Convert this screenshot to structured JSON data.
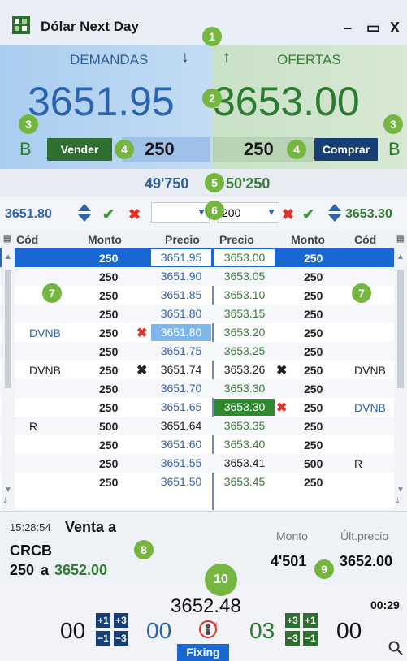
{
  "window": {
    "title": "Dólar Next Day",
    "controls": {
      "minimize": "–",
      "maximize": "▭",
      "close": "X"
    }
  },
  "header": {
    "demand_label": "DEMANDAS",
    "offer_label": "OFERTAS",
    "bid": "3651.95",
    "ask": "3653.00",
    "b_left": "B",
    "b_right": "B",
    "sell_button": "Vender",
    "buy_button": "Comprar",
    "sell_qty": "250",
    "buy_qty": "250",
    "vol_left": "49'750",
    "vol_right": "50'250"
  },
  "controls_row": {
    "left_price": "3651.80",
    "right_qty": "200",
    "right_price": "3653.30"
  },
  "table": {
    "headers": {
      "cod_l": "Cód",
      "mon_l": "Monto",
      "pre_l": "Precio",
      "pre_r": "Precio",
      "mon_r": "Monto",
      "cod_r": "Cód"
    },
    "rows": [
      {
        "cod_l": "",
        "mon_l": "250",
        "pre_l": "3651.95",
        "pre_r": "3653.00",
        "mon_r": "250",
        "cod_r": ""
      },
      {
        "cod_l": "",
        "mon_l": "250",
        "pre_l": "3651.90",
        "pre_r": "3653.05",
        "mon_r": "250",
        "cod_r": ""
      },
      {
        "cod_l": "",
        "mon_l": "250",
        "pre_l": "3651.85",
        "pre_r": "3653.10",
        "mon_r": "250",
        "cod_r": ""
      },
      {
        "cod_l": "",
        "mon_l": "250",
        "pre_l": "3651.80",
        "pre_r": "3653.15",
        "mon_r": "250",
        "cod_r": ""
      },
      {
        "cod_l": "DVNB",
        "mon_l": "250",
        "pre_l": "3651.80",
        "pre_r": "3653.20",
        "mon_r": "250",
        "cod_r": ""
      },
      {
        "cod_l": "",
        "mon_l": "250",
        "pre_l": "3651.75",
        "pre_r": "3653.25",
        "mon_r": "250",
        "cod_r": ""
      },
      {
        "cod_l": "DVNB",
        "mon_l": "250",
        "pre_l": "3651.74",
        "pre_r": "3653.26",
        "mon_r": "250",
        "cod_r": "DVNB"
      },
      {
        "cod_l": "",
        "mon_l": "250",
        "pre_l": "3651.70",
        "pre_r": "3653.30",
        "mon_r": "250",
        "cod_r": ""
      },
      {
        "cod_l": "",
        "mon_l": "250",
        "pre_l": "3651.65",
        "pre_r": "3653.30",
        "mon_r": "250",
        "cod_r": "DVNB"
      },
      {
        "cod_l": "R",
        "mon_l": "500",
        "pre_l": "3651.64",
        "pre_r": "3653.35",
        "mon_r": "250",
        "cod_r": ""
      },
      {
        "cod_l": "",
        "mon_l": "250",
        "pre_l": "3651.60",
        "pre_r": "3653.40",
        "mon_r": "250",
        "cod_r": ""
      },
      {
        "cod_l": "",
        "mon_l": "250",
        "pre_l": "3651.55",
        "pre_r": "3653.41",
        "mon_r": "500",
        "cod_r": "R"
      },
      {
        "cod_l": "",
        "mon_l": "250",
        "pre_l": "3651.50",
        "pre_r": "3653.45",
        "mon_r": "250",
        "cod_r": ""
      }
    ]
  },
  "bottom": {
    "time": "15:28:54",
    "trade_label": "Venta a",
    "counterparty": "CRCB",
    "trade_qty": "250",
    "trade_price": "3652.00",
    "monto_label": "Monto",
    "ult_label": "Últ.precio",
    "monto_value": "4'501",
    "ult_value": "3652.00"
  },
  "fixing": {
    "price": "3652.48",
    "time": "00:29",
    "label": "Fixing",
    "left_main": "00",
    "left_sub": "00",
    "right_main": "03",
    "right_sub": "00",
    "l_top1": "+1",
    "l_top2": "+3",
    "l_bot1": "−1",
    "l_bot2": "−3",
    "r_top1": "+3",
    "r_top2": "+1",
    "r_bot1": "−3",
    "r_bot2": "−1"
  },
  "badges": [
    "1",
    "2",
    "3",
    "3",
    "4",
    "4",
    "5",
    "6",
    "7",
    "7",
    "8",
    "9",
    "10"
  ]
}
